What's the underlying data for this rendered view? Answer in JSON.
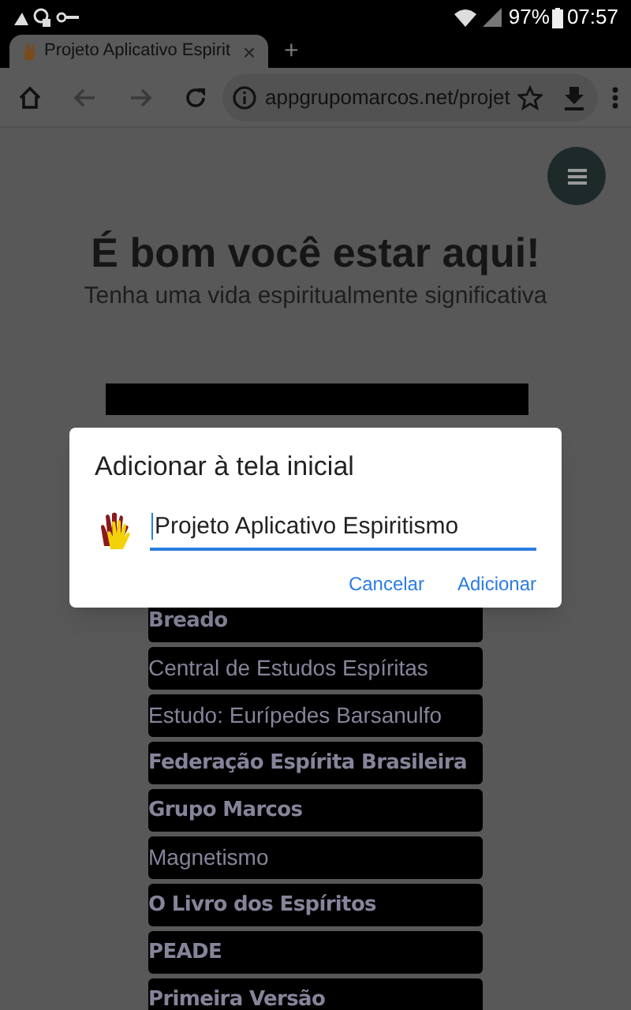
{
  "status_bar": {
    "battery": "97%",
    "time": "07:57"
  },
  "browser": {
    "tab_title": "Projeto Aplicativo Espirit",
    "tab_close": "×",
    "new_tab": "+",
    "url": "appgrupomarcos.net/projet"
  },
  "page": {
    "heading": "É bom você estar aqui!",
    "subheading": "Tenha uma vida espiritualmente significativa",
    "links": [
      {
        "label": "Breado",
        "kind": "display"
      },
      {
        "label": "Central de Estudos Espíritas",
        "kind": "sans"
      },
      {
        "label": "Estudo: Eurípedes Barsanulfo",
        "kind": "sans"
      },
      {
        "label": "Federação Espírita Brasileira",
        "kind": "display"
      },
      {
        "label": "Grupo Marcos",
        "kind": "display"
      },
      {
        "label": "Magnetismo",
        "kind": "sans"
      },
      {
        "label": "O Livro dos Espíritos",
        "kind": "display"
      },
      {
        "label": "PEADE",
        "kind": "display"
      },
      {
        "label": "Primeira Versão",
        "kind": "display"
      }
    ]
  },
  "dialog": {
    "title": "Adicionar à tela inicial",
    "name_value": "Projeto Aplicativo Espiritismo",
    "buttons": [
      "Cancelar",
      "Adicionar"
    ]
  }
}
